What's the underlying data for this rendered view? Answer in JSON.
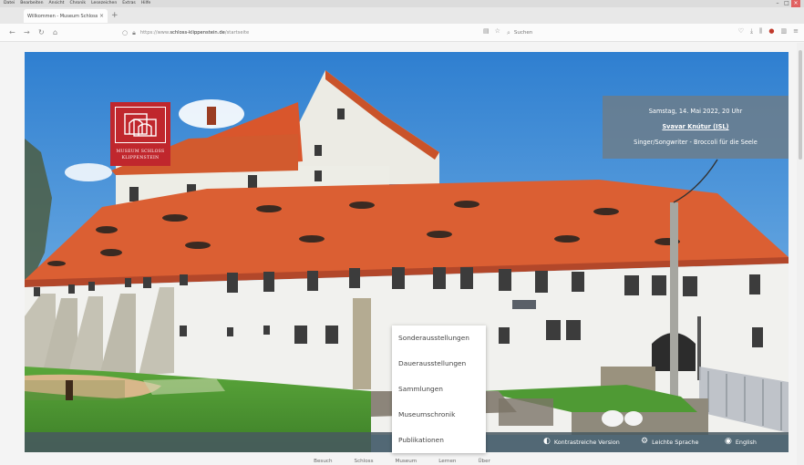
{
  "menu": [
    "Datei",
    "Bearbeiten",
    "Ansicht",
    "Chronik",
    "Lesezeichen",
    "Extras",
    "Hilfe"
  ],
  "tab": {
    "title": "Willkommen - Museum Schloss Klippenstein",
    "close": "×",
    "new": "+"
  },
  "nav": {
    "back": "←",
    "forward": "→",
    "reload": "↻",
    "home": "⌂"
  },
  "url": {
    "prefix": "https://www.",
    "domain": "schloss-klippenstein.de",
    "path": "/startseite"
  },
  "search": {
    "placeholder": "Suchen"
  },
  "hero": {
    "logo": {
      "line1": "MUSEUM SCHLOSS",
      "line2": "KLIPPENSTEIN"
    },
    "event": {
      "date": "Samstag, 14. Mai 2022, 20 Uhr",
      "title": "Svavar Knútur (ISL)",
      "subtitle": "Singer/Songwriter - Broccoli für die Seele"
    }
  },
  "dropdown": [
    "Sonderausstellungen",
    "Dauerausstellungen",
    "Sammlungen",
    "Museumschronik",
    "Publikationen"
  ],
  "bottombar": {
    "contrast": "Kontrastreiche Version",
    "easy": "Leichte Sprache",
    "english": "English"
  },
  "footer_nav": [
    "Besuch",
    "Schloss",
    "Museum",
    "Lernen",
    "Über"
  ],
  "colors": {
    "brand_red": "#c0272d",
    "overlay": "#6e7d87",
    "bar": "#485860"
  }
}
